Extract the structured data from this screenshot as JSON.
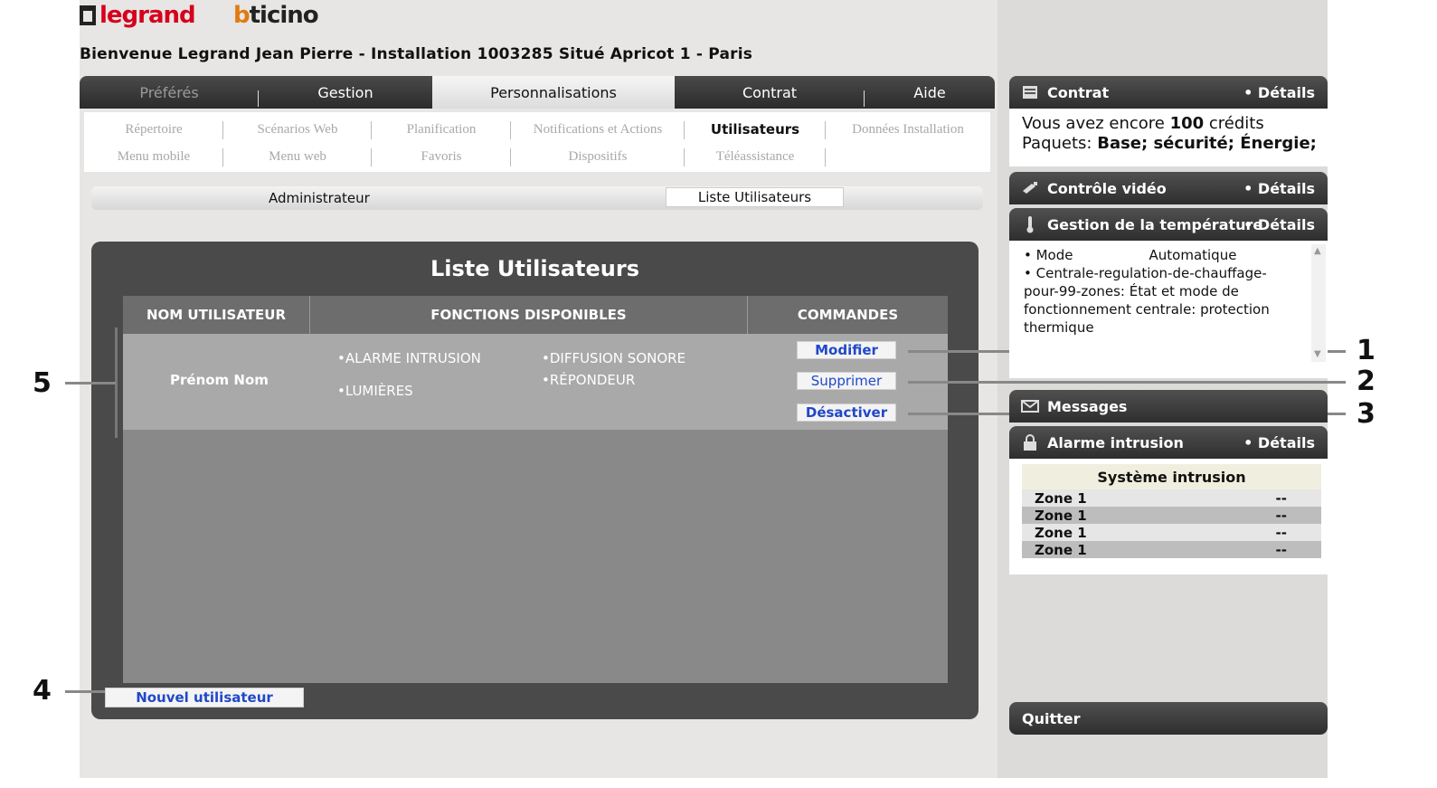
{
  "logos": {
    "legrand": "legrand",
    "bticino_b": "b",
    "bticino_rest": "ticino"
  },
  "welcome": "Bienvenue Legrand Jean Pierre - Installation 1003285 Situé Apricot 1 - Paris",
  "main_tabs": [
    "Préférés",
    "Gestion",
    "Personnalisations",
    "Contrat",
    "Aide"
  ],
  "sub_menu": {
    "row1": [
      "Répertoire",
      "Scénarios Web",
      "Planification",
      "Notifications et Actions",
      "Utilisateurs",
      "Données Installation"
    ],
    "row2": [
      "Menu mobile",
      "Menu web",
      "Favoris",
      "Dispositifs",
      "Téléassistance"
    ]
  },
  "admin_bar": {
    "label": "Administrateur",
    "tab": "Liste Utilisateurs"
  },
  "panel": {
    "title": "Liste Utilisateurs",
    "headers": [
      "NOM UTILISATEUR",
      "FONCTIONS DISPONIBLES",
      "COMMANDES"
    ],
    "user": "Prénom Nom",
    "functions": [
      "•ALARME INTRUSION",
      "•LUMIÈRES",
      "•DIFFUSION SONORE",
      "•RÉPONDEUR"
    ],
    "commands": [
      "Modifier",
      "Supprimer",
      "Désactiver"
    ],
    "new_user": "Nouvel utilisateur"
  },
  "callouts": [
    "1",
    "2",
    "3",
    "4",
    "5"
  ],
  "sidebar": {
    "contrat": {
      "title": "Contrat",
      "details": "• Détails",
      "line1_prefix": "Vous avez encore ",
      "credits": "100",
      "line1_suffix": " crédits",
      "line2_prefix": "Paquets: ",
      "packages": "Base; sécurité; Énergie;"
    },
    "video": {
      "title": "Contrôle vidéo",
      "details": "• Détails"
    },
    "temperature": {
      "title": "Gestion de la température",
      "details": "• Détails",
      "mode_label": "• Mode",
      "mode_value": "Automatique",
      "line2": "• Centrale-regulation-de-chauffage-pour-99-zones: État et mode de fonctionnement centrale: protection thermique"
    },
    "messages": {
      "title": "Messages"
    },
    "alarme": {
      "title": "Alarme intrusion",
      "details": "• Détails",
      "system": "Système intrusion",
      "zones": [
        {
          "name": "Zone 1",
          "value": "--"
        },
        {
          "name": "Zone 1",
          "value": "--"
        },
        {
          "name": "Zone 1",
          "value": "--"
        },
        {
          "name": "Zone 1",
          "value": "--"
        }
      ]
    },
    "quitter": "Quitter"
  },
  "icons": {
    "contrat": "document-icon",
    "video": "camera-icon",
    "temperature": "thermometer-icon",
    "messages": "envelope-icon",
    "alarme": "lock-icon"
  }
}
